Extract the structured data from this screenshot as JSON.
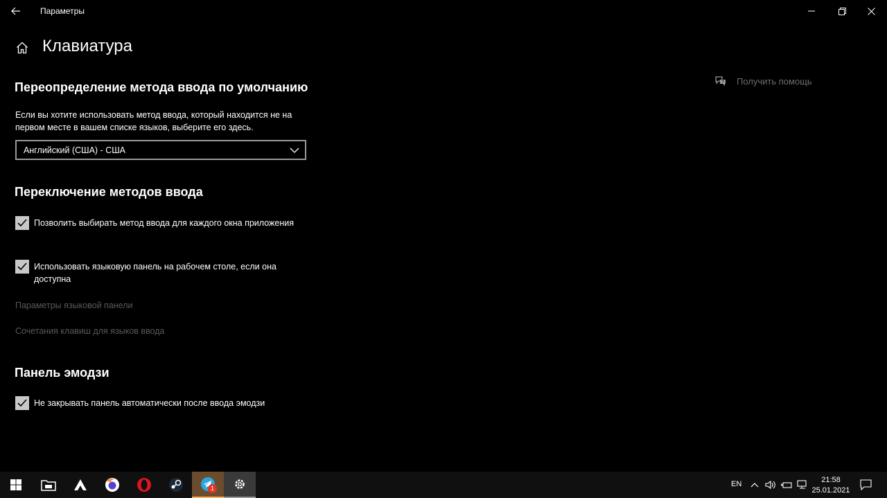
{
  "window": {
    "title": "Параметры"
  },
  "page": {
    "title": "Клавиатура",
    "help_label": "Получить помощь"
  },
  "override": {
    "heading": "Переопределение метода ввода по умолчанию",
    "description": "Если вы хотите использовать метод ввода, который находится не на первом месте в вашем списке языков, выберите его здесь.",
    "selected": "Английский (США) - США"
  },
  "switching": {
    "heading": "Переключение методов ввода",
    "options": [
      {
        "label": "Позволить выбирать метод ввода для каждого окна приложения",
        "checked": true
      },
      {
        "label": "Использовать языковую панель на рабочем столе, если она доступна",
        "checked": true
      }
    ],
    "links": [
      "Параметры языковой панели",
      "Сочетания клавиш для языков ввода"
    ]
  },
  "emoji": {
    "heading": "Панель эмодзи",
    "option": {
      "label": "Не закрывать панель автоматически после ввода эмодзи",
      "checked": true
    }
  },
  "taskbar": {
    "apps": [
      "start-icon",
      "file-explorer-icon",
      "arc-icon",
      "firefox-icon",
      "opera-icon",
      "steam-icon",
      "telegram-icon",
      "settings-icon"
    ],
    "telegram_badge": "1",
    "language": "EN",
    "time": "21:58",
    "date": "25.01.2021"
  },
  "colors": {
    "background": "#000000",
    "checkbox": "#c8c8c8",
    "disabled_text": "#5a5a5a",
    "taskbar": "#101010"
  }
}
